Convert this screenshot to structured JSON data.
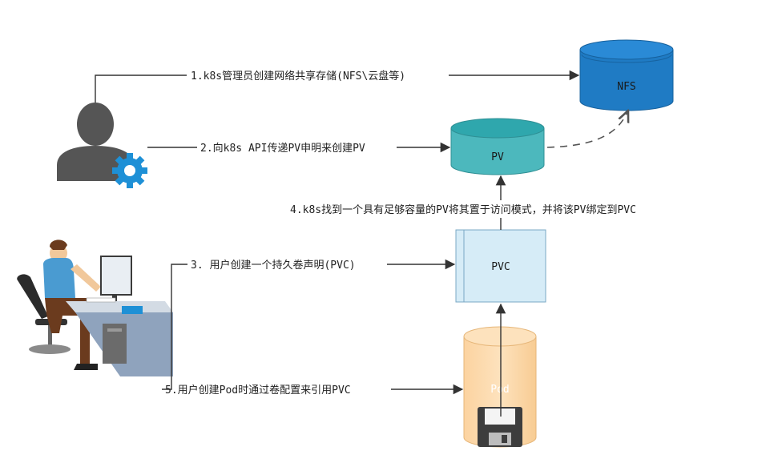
{
  "nodes": {
    "nfs": "NFS",
    "pv": "PV",
    "pvc": "PVC",
    "pod": "Pod"
  },
  "steps": {
    "s1": "1.k8s管理员创建网络共享存储(NFS\\云盘等)",
    "s2": "2.向k8s API传递PV申明来创建PV",
    "s3": "3. 用户创建一个持久卷声明(PVC)",
    "s4": "4.k8s找到一个具有足够容量的PV将其置于访问模式，并将该PV绑定到PVC",
    "s5": "5.用户创建Pod时通过卷配置来引用PVC"
  },
  "colors": {
    "nfs": "#1f7bc4",
    "pv": "#4cb8bd",
    "pvc": "#d6ecf7",
    "pod": "#fcd9a8",
    "admin": "#555555",
    "gear": "#1e90d6"
  },
  "icons": {
    "admin": "admin-user-gear-icon",
    "user": "user-at-desk-icon",
    "disk": "floppy-disk-icon"
  }
}
